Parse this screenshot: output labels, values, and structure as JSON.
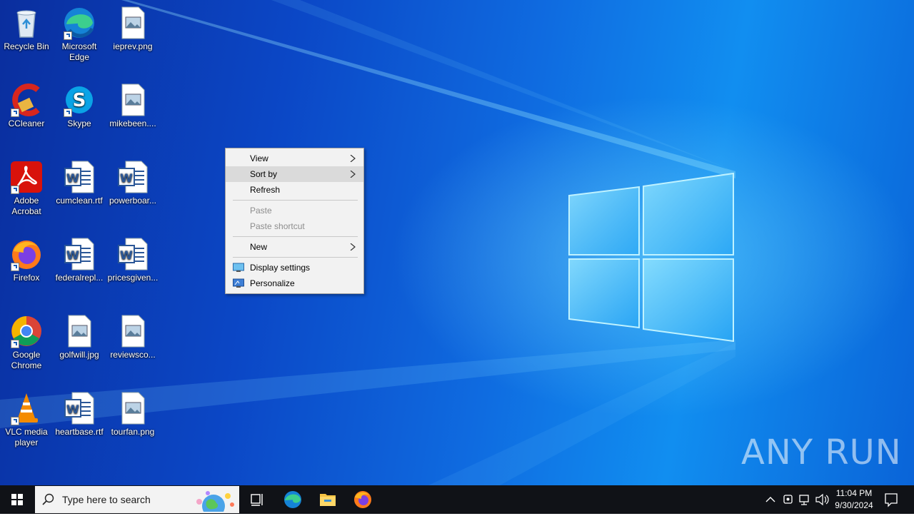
{
  "desktop": {
    "icons": [
      {
        "label": "Recycle Bin",
        "icon": "recycle-bin-icon"
      },
      {
        "label": "Microsoft Edge",
        "icon": "edge-icon"
      },
      {
        "label": "ieprev.png",
        "icon": "image-file-icon"
      },
      {
        "label": "CCleaner",
        "icon": "ccleaner-icon"
      },
      {
        "label": "Skype",
        "icon": "skype-icon"
      },
      {
        "label": "mikebeen....",
        "icon": "image-file-icon"
      },
      {
        "label": "Adobe Acrobat",
        "icon": "acrobat-icon"
      },
      {
        "label": "cumclean.rtf",
        "icon": "word-file-icon"
      },
      {
        "label": "powerboar...",
        "icon": "word-file-icon"
      },
      {
        "label": "Firefox",
        "icon": "firefox-icon"
      },
      {
        "label": "federalrepl...",
        "icon": "word-file-icon"
      },
      {
        "label": "pricesgiven...",
        "icon": "word-file-icon"
      },
      {
        "label": "Google Chrome",
        "icon": "chrome-icon"
      },
      {
        "label": "golfwill.jpg",
        "icon": "image-file-icon"
      },
      {
        "label": "reviewsco...",
        "icon": "image-file-icon"
      },
      {
        "label": "VLC media player",
        "icon": "vlc-icon"
      },
      {
        "label": "heartbase.rtf",
        "icon": "word-file-icon"
      },
      {
        "label": "tourfan.png",
        "icon": "image-file-icon"
      }
    ]
  },
  "context_menu": {
    "view": "View",
    "sort_by": "Sort by",
    "refresh": "Refresh",
    "paste": "Paste",
    "paste_shortcut": "Paste shortcut",
    "new": "New",
    "display_settings": "Display settings",
    "personalize": "Personalize"
  },
  "taskbar": {
    "search_placeholder": "Type here to search",
    "time": "11:04 PM",
    "date": "9/30/2024",
    "pinned": [
      "task-view-icon",
      "edge-icon",
      "file-explorer-icon",
      "firefox-icon"
    ]
  },
  "watermark": "ANY RUN",
  "colors": {
    "accent": "#0f6be0",
    "menu_bg": "#f2f2f2",
    "menu_hover": "#dadada",
    "taskbar": "#101217"
  }
}
